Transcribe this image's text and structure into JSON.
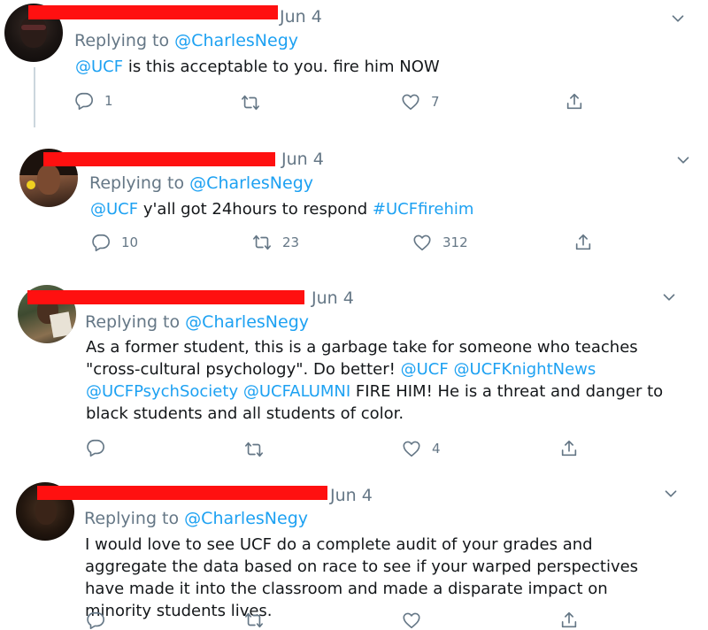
{
  "tweets": [
    {
      "date": "Jun 4",
      "reply_prefix": "Replying to",
      "reply_to": "@CharlesNegy",
      "body": [
        {
          "t": "@UCF",
          "link": true
        },
        {
          "t": " is this acceptable to you. fire him NOW",
          "link": false
        }
      ],
      "replies": "1",
      "retweets": "",
      "likes": "7"
    },
    {
      "date": "Jun 4",
      "reply_prefix": "Replying to",
      "reply_to": "@CharlesNegy",
      "body": [
        {
          "t": "@UCF",
          "link": true
        },
        {
          "t": " y'all got 24hours to respond ",
          "link": false
        },
        {
          "t": "#UCFfirehim",
          "link": true
        }
      ],
      "replies": "10",
      "retweets": "23",
      "likes": "312"
    },
    {
      "date": "Jun 4",
      "reply_prefix": "Replying to",
      "reply_to": "@CharlesNegy",
      "body": [
        {
          "t": "As a former student, this is a garbage take for someone who teaches \"cross-cultural psychology\". Do better! ",
          "link": false
        },
        {
          "t": "@UCF",
          "link": true
        },
        {
          "t": " ",
          "link": false
        },
        {
          "t": "@UCFKnightNews",
          "link": true
        },
        {
          "t": " ",
          "link": false
        },
        {
          "t": "@UCFPsychSociety",
          "link": true
        },
        {
          "t": " ",
          "link": false
        },
        {
          "t": "@UCFALUMNI",
          "link": true
        },
        {
          "t": " FIRE HIM! He is a threat and danger to black students and all students of color.",
          "link": false
        }
      ],
      "replies": "",
      "retweets": "",
      "likes": "4"
    },
    {
      "date": "Jun 4",
      "reply_prefix": "Replying to",
      "reply_to": "@CharlesNegy",
      "body": [
        {
          "t": "I would love to see UCF do a complete audit of your grades and aggregate the data based on race to see if your warped perspectives have made it into the classroom and made a disparate impact on minority students lives.",
          "link": false
        }
      ],
      "replies": "",
      "retweets": "",
      "likes": ""
    }
  ],
  "colors": {
    "text": "#14171a",
    "muted": "#657786",
    "link": "#1da1f2",
    "redaction": "#ff1010"
  },
  "icons": [
    "reply-icon",
    "retweet-icon",
    "like-icon",
    "share-icon",
    "chevron-down-icon"
  ]
}
